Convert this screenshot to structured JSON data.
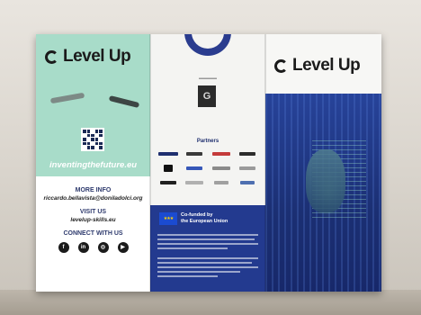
{
  "brochure": {
    "left_panel": {
      "brand": "Level Up",
      "tagline": "inventingthefuture.eu",
      "info": [
        {
          "heading": "MORE INFO",
          "value": "riccardo.bellavista@doniladolci.org"
        },
        {
          "heading": "VISIT US",
          "value": "levelup-skills.eu"
        }
      ],
      "connect_heading": "CONNECT WITH US",
      "social_icons": [
        "facebook-icon",
        "linkedin-icon",
        "instagram-icon",
        "youtube-icon"
      ]
    },
    "middle_panel": {
      "partners_title": "Partners",
      "eu_funding": "Co-funded by\nthe European Union"
    },
    "right_panel": {
      "brand": "Level Up"
    }
  },
  "colors": {
    "mint": "#a8dcc9",
    "navy": "#1e3a8a",
    "eu_blue": "#1b4bd1",
    "eu_yellow": "#ffd400"
  }
}
